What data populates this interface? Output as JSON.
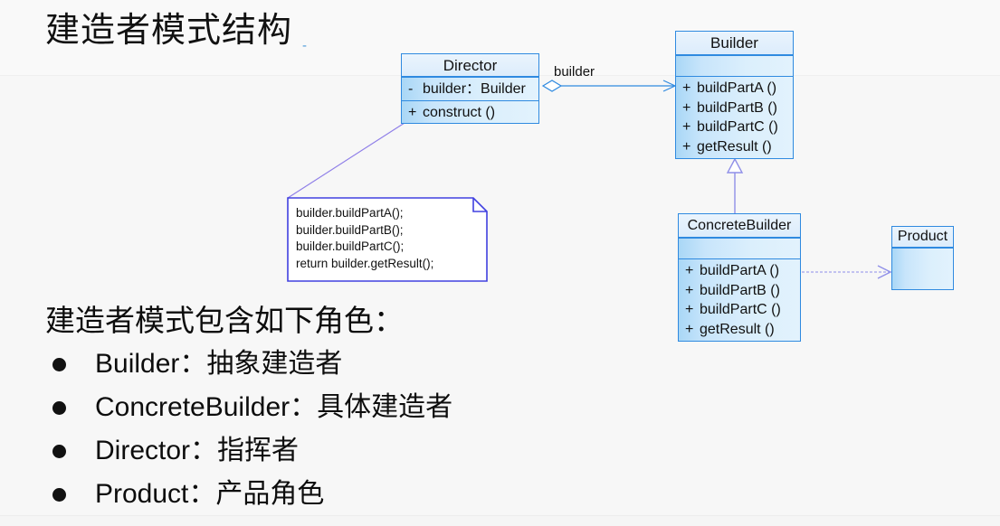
{
  "slide": {
    "title": "建造者模式结构",
    "title_dash": "-",
    "roles_heading": "建造者模式包含如下角色："
  },
  "roles": [
    {
      "bullet": "●",
      "text": "Builder：抽象建造者"
    },
    {
      "bullet": "●",
      "text": "ConcreteBuilder：具体建造者"
    },
    {
      "bullet": "●",
      "text": "Director：指挥者"
    },
    {
      "bullet": "●",
      "text": "Product：产品角色"
    }
  ],
  "diagram": {
    "classes": {
      "director": {
        "name": "Director",
        "attributes": [
          {
            "visibility": "-",
            "text": "builder：Builder"
          }
        ],
        "operations": [
          {
            "visibility": "+",
            "text": "construct ()"
          }
        ]
      },
      "builder": {
        "name": "Builder",
        "attributes": [],
        "operations": [
          {
            "visibility": "+",
            "text": "buildPartA ()"
          },
          {
            "visibility": "+",
            "text": "buildPartB ()"
          },
          {
            "visibility": "+",
            "text": "buildPartC ()"
          },
          {
            "visibility": "+",
            "text": "getResult ()"
          }
        ]
      },
      "concrete_builder": {
        "name": "ConcreteBuilder",
        "attributes": [],
        "operations": [
          {
            "visibility": "+",
            "text": "buildPartA ()"
          },
          {
            "visibility": "+",
            "text": "buildPartB ()"
          },
          {
            "visibility": "+",
            "text": "buildPartC ()"
          },
          {
            "visibility": "+",
            "text": "getResult ()"
          }
        ]
      },
      "product": {
        "name": "Product",
        "attributes": [],
        "operations": []
      }
    },
    "note": {
      "text": "builder.buildPartA();\nbuilder.buildPartB();\nbuilder.buildPartC();\nreturn builder.getResult();"
    },
    "relations": {
      "aggregation_label": "builder"
    },
    "colors": {
      "class_border": "#2f8ae0",
      "class_header_fill": "#e6f2fd",
      "class_body_fill": "#cfe8fb",
      "association_line": "#2f8ae0",
      "generalization_line": "#8f8fe8",
      "dependency_line": "#b0b0ee",
      "note_border": "#4040e0",
      "note_fill": "#ffffff",
      "text": "#111111"
    }
  }
}
